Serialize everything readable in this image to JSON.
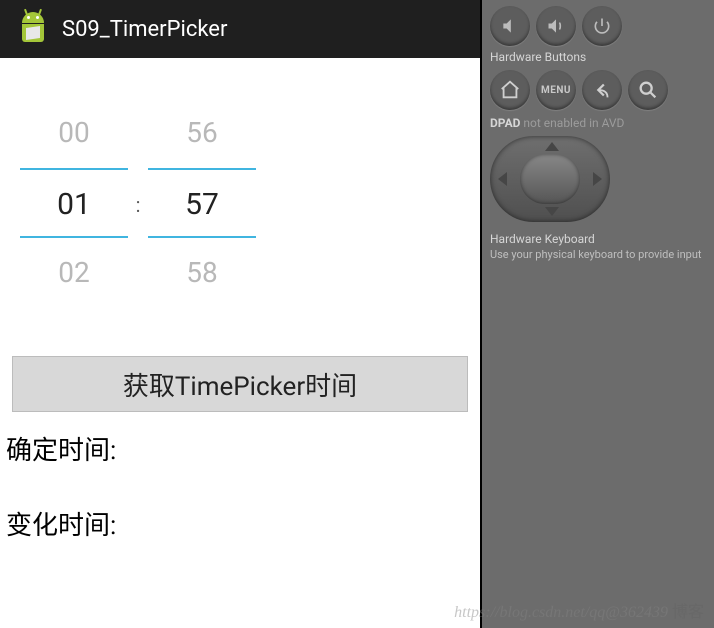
{
  "action_bar": {
    "title": "S09_TimerPicker"
  },
  "time_picker": {
    "hour_prev": "00",
    "hour_current": "01",
    "hour_next": "02",
    "minute_prev": "56",
    "minute_current": "57",
    "minute_next": "58",
    "separator": ":"
  },
  "button": {
    "get_time": "获取TimePicker时间"
  },
  "labels": {
    "confirm_time": "确定时间:",
    "change_time": "变化时间:"
  },
  "emulator": {
    "hardware_buttons_label": "Hardware Buttons",
    "menu_label": "MENU",
    "dpad_label": "DPAD",
    "dpad_status": "not enabled in AVD",
    "hw_keyboard_label": "Hardware Keyboard",
    "hw_keyboard_sub": "Use your physical keyboard to provide input"
  },
  "watermark": {
    "url_part": "https://blog.csdn.net/qq@362439",
    "suffix": "博客"
  }
}
